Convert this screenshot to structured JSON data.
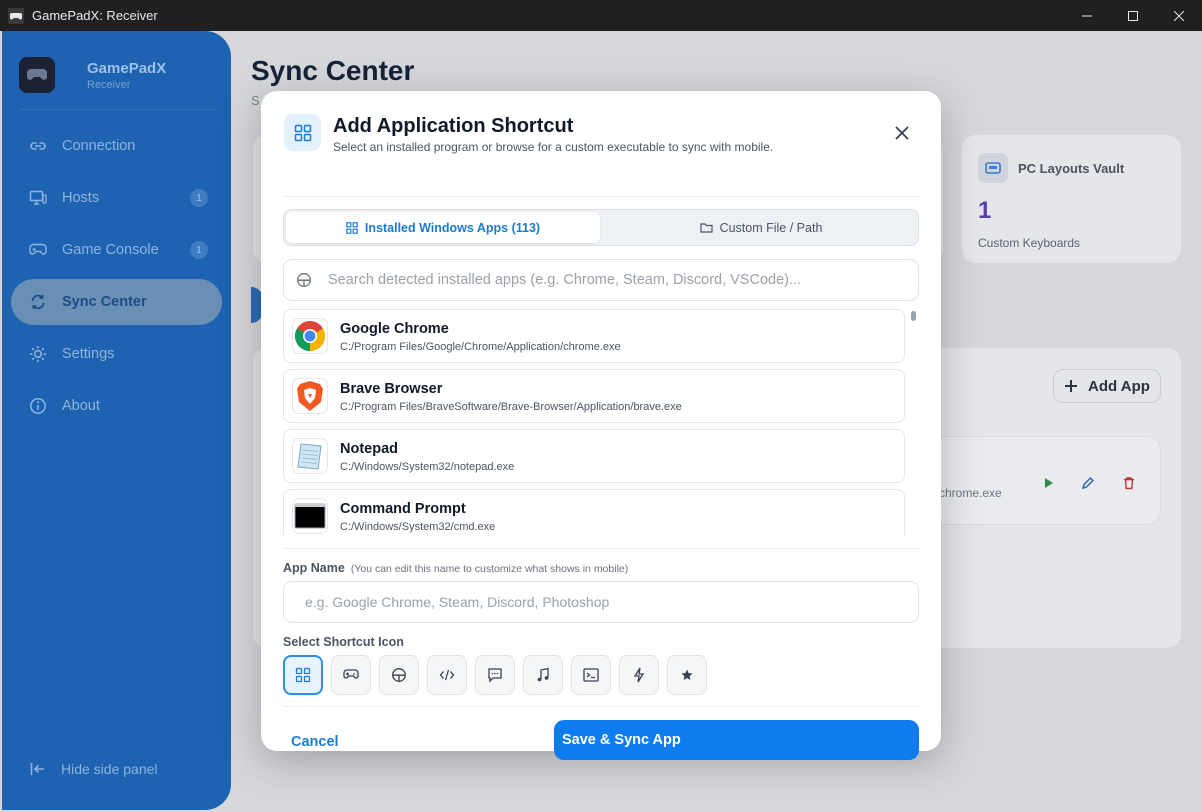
{
  "window": {
    "title": "GamePadX: Receiver"
  },
  "sidebar": {
    "brand_name": "GamePadX",
    "brand_sub": "Receiver",
    "items": [
      {
        "label": "Connection",
        "icon": "link-icon"
      },
      {
        "label": "Hosts",
        "icon": "monitor-icon",
        "badge": "1"
      },
      {
        "label": "Game Console",
        "icon": "gamepad-icon",
        "badge": "1"
      },
      {
        "label": "Sync Center",
        "icon": "sync-icon",
        "active": true
      },
      {
        "label": "Settings",
        "icon": "sun-gear-icon"
      },
      {
        "label": "About",
        "icon": "info-icon"
      }
    ],
    "hide_panel_label": "Hide side panel"
  },
  "page": {
    "title": "Sync Center",
    "subtitle_fragment": "S",
    "vault": {
      "title": "PC Layouts Vault",
      "count": "1",
      "label": "Custom Keyboards"
    },
    "add_app_label": "Add App",
    "path_fragment": "n/chrome.exe"
  },
  "modal": {
    "title": "Add Application Shortcut",
    "subtitle": "Select an installed program or browse for a custom executable to sync with mobile.",
    "tabs": [
      {
        "label": "Installed Windows Apps (113)",
        "active": true
      },
      {
        "label": "Custom File / Path",
        "active": false
      }
    ],
    "search_placeholder": "Search detected installed apps (e.g. Chrome, Steam, Discord, VSCode)...",
    "apps": [
      {
        "name": "Google Chrome",
        "path": "C:/Program Files/Google/Chrome/Application/chrome.exe",
        "icon": "chrome-icon"
      },
      {
        "name": "Brave Browser",
        "path": "C:/Program Files/BraveSoftware/Brave-Browser/Application/brave.exe",
        "icon": "brave-icon"
      },
      {
        "name": "Notepad",
        "path": "C:/Windows/System32/notepad.exe",
        "icon": "notepad-icon"
      },
      {
        "name": "Command Prompt",
        "path": "C:/Windows/System32/cmd.exe",
        "icon": "cmd-icon"
      }
    ],
    "app_name_label": "App Name",
    "app_name_hint": "(You can edit this name to customize what shows in mobile)",
    "app_name_placeholder": "e.g. Google Chrome, Steam, Discord, Photoshop",
    "icon_label": "Select Shortcut Icon",
    "icon_options": [
      "grid-icon",
      "gamepad-icon",
      "steering-wheel-icon",
      "code-icon",
      "chat-icon",
      "music-note-icon",
      "terminal-icon",
      "lightning-icon",
      "star-icon"
    ],
    "selected_icon": "grid-icon",
    "cancel_label": "Cancel",
    "save_label": "Save & Sync App"
  },
  "colors": {
    "accent": "#0d7cf0",
    "sidebar": "#1d63b2",
    "overlay_bg": "#d5d7db"
  }
}
